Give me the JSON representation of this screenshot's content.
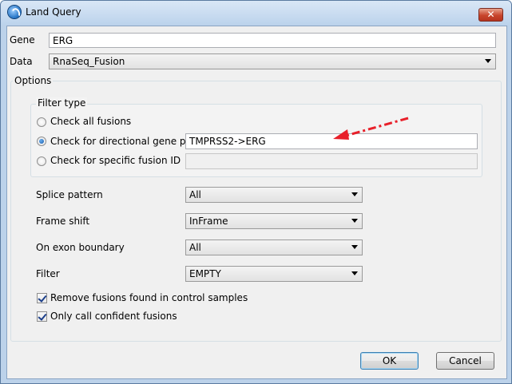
{
  "window": {
    "title": "Land Query",
    "close_glyph": "✕"
  },
  "gene": {
    "label": "Gene",
    "value": "ERG"
  },
  "data": {
    "label": "Data",
    "selected": "RnaSeq_Fusion"
  },
  "options": {
    "title": "Options",
    "filter_type": {
      "title": "Filter type",
      "check_all_label": "Check all fusions",
      "directional_label": "Check for directional gene pair",
      "directional_value": "TMPRSS2->ERG",
      "specific_label": "Check for specific fusion ID",
      "specific_value": "",
      "selected": "directional"
    },
    "splice_pattern": {
      "label": "Splice pattern",
      "selected": "All"
    },
    "frame_shift": {
      "label": "Frame shift",
      "selected": "InFrame"
    },
    "exon_boundary": {
      "label": "On exon boundary",
      "selected": "All"
    },
    "filter": {
      "label": "Filter",
      "selected": "EMPTY"
    },
    "remove_control": {
      "label": "Remove fusions found in control samples",
      "checked": true
    },
    "confident_only": {
      "label": "Only call confident fusions",
      "checked": true
    }
  },
  "buttons": {
    "ok": "OK",
    "cancel": "Cancel"
  },
  "annotation": {
    "color": "#e8202a",
    "icon": "dashed-arrow-icon"
  }
}
